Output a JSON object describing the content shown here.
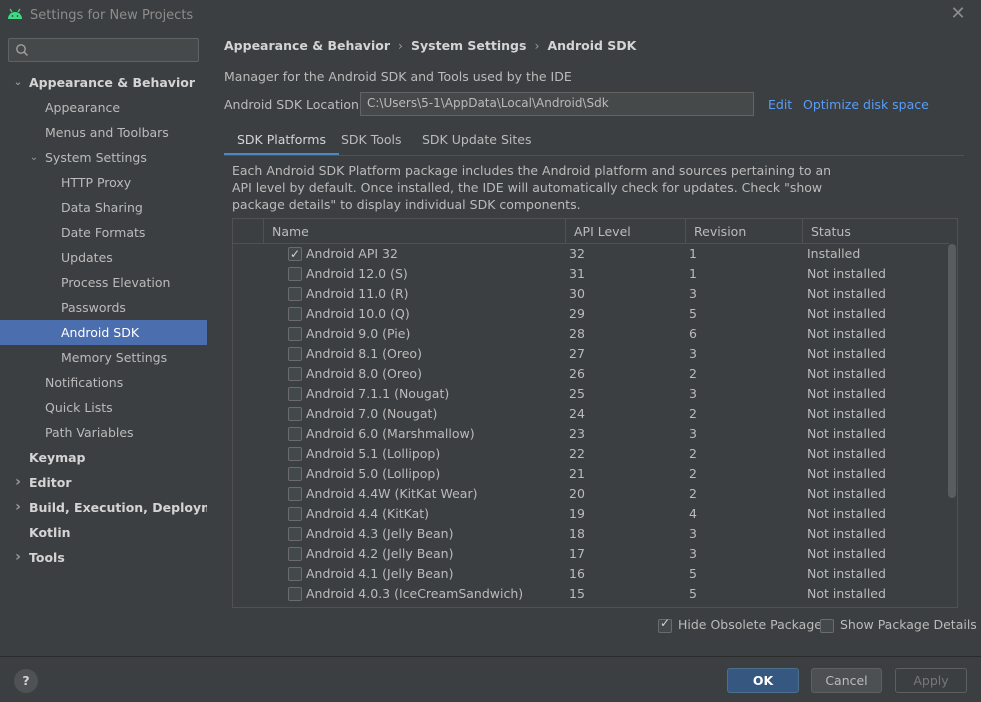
{
  "window": {
    "title": "Settings for New Projects"
  },
  "search": {
    "placeholder": ""
  },
  "sidebar": {
    "items": [
      {
        "label": "Appearance & Behavior",
        "level": 0,
        "bold": true,
        "arrow": "expanded"
      },
      {
        "label": "Appearance",
        "level": 1
      },
      {
        "label": "Menus and Toolbars",
        "level": 1
      },
      {
        "label": "System Settings",
        "level": 1,
        "arrow": "expanded"
      },
      {
        "label": "HTTP Proxy",
        "level": 2
      },
      {
        "label": "Data Sharing",
        "level": 2
      },
      {
        "label": "Date Formats",
        "level": 2
      },
      {
        "label": "Updates",
        "level": 2
      },
      {
        "label": "Process Elevation",
        "level": 2
      },
      {
        "label": "Passwords",
        "level": 2
      },
      {
        "label": "Android SDK",
        "level": 2,
        "selected": true
      },
      {
        "label": "Memory Settings",
        "level": 2
      },
      {
        "label": "Notifications",
        "level": 1
      },
      {
        "label": "Quick Lists",
        "level": 1
      },
      {
        "label": "Path Variables",
        "level": 1
      },
      {
        "label": "Keymap",
        "level": 0,
        "bold": true
      },
      {
        "label": "Editor",
        "level": 0,
        "bold": true,
        "arrow": "collapsed"
      },
      {
        "label": "Build, Execution, Deployment",
        "level": 0,
        "bold": true,
        "arrow": "collapsed"
      },
      {
        "label": "Kotlin",
        "level": 0,
        "bold": true
      },
      {
        "label": "Tools",
        "level": 0,
        "bold": true,
        "arrow": "collapsed"
      }
    ]
  },
  "breadcrumb": [
    "Appearance & Behavior",
    "System Settings",
    "Android SDK"
  ],
  "main": {
    "description": "Manager for the Android SDK and Tools used by the IDE",
    "location_label": "Android SDK Location:",
    "location_value": "C:\\Users\\5-1\\AppData\\Local\\Android\\Sdk",
    "edit_link": "Edit",
    "optimize_link": "Optimize disk space",
    "tabs": [
      "SDK Platforms",
      "SDK Tools",
      "SDK Update Sites"
    ],
    "active_tab": "SDK Platforms",
    "info": "Each Android SDK Platform package includes the Android platform and sources pertaining to an API level by default. Once installed, the IDE will automatically check for updates. Check \"show package details\" to display individual SDK components."
  },
  "table": {
    "columns": [
      "Name",
      "API Level",
      "Revision",
      "Status"
    ],
    "rows": [
      {
        "checked": true,
        "name": "Android API 32",
        "api": "32",
        "rev": "1",
        "status": "Installed"
      },
      {
        "checked": false,
        "name": "Android 12.0 (S)",
        "api": "31",
        "rev": "1",
        "status": "Not installed"
      },
      {
        "checked": false,
        "name": "Android 11.0 (R)",
        "api": "30",
        "rev": "3",
        "status": "Not installed"
      },
      {
        "checked": false,
        "name": "Android 10.0 (Q)",
        "api": "29",
        "rev": "5",
        "status": "Not installed"
      },
      {
        "checked": false,
        "name": "Android 9.0 (Pie)",
        "api": "28",
        "rev": "6",
        "status": "Not installed"
      },
      {
        "checked": false,
        "name": "Android 8.1 (Oreo)",
        "api": "27",
        "rev": "3",
        "status": "Not installed"
      },
      {
        "checked": false,
        "name": "Android 8.0 (Oreo)",
        "api": "26",
        "rev": "2",
        "status": "Not installed"
      },
      {
        "checked": false,
        "name": "Android 7.1.1 (Nougat)",
        "api": "25",
        "rev": "3",
        "status": "Not installed"
      },
      {
        "checked": false,
        "name": "Android 7.0 (Nougat)",
        "api": "24",
        "rev": "2",
        "status": "Not installed"
      },
      {
        "checked": false,
        "name": "Android 6.0 (Marshmallow)",
        "api": "23",
        "rev": "3",
        "status": "Not installed"
      },
      {
        "checked": false,
        "name": "Android 5.1 (Lollipop)",
        "api": "22",
        "rev": "2",
        "status": "Not installed"
      },
      {
        "checked": false,
        "name": "Android 5.0 (Lollipop)",
        "api": "21",
        "rev": "2",
        "status": "Not installed"
      },
      {
        "checked": false,
        "name": "Android 4.4W (KitKat Wear)",
        "api": "20",
        "rev": "2",
        "status": "Not installed"
      },
      {
        "checked": false,
        "name": "Android 4.4 (KitKat)",
        "api": "19",
        "rev": "4",
        "status": "Not installed"
      },
      {
        "checked": false,
        "name": "Android 4.3 (Jelly Bean)",
        "api": "18",
        "rev": "3",
        "status": "Not installed"
      },
      {
        "checked": false,
        "name": "Android 4.2 (Jelly Bean)",
        "api": "17",
        "rev": "3",
        "status": "Not installed"
      },
      {
        "checked": false,
        "name": "Android 4.1 (Jelly Bean)",
        "api": "16",
        "rev": "5",
        "status": "Not installed"
      },
      {
        "checked": false,
        "name": "Android 4.0.3 (IceCreamSandwich)",
        "api": "15",
        "rev": "5",
        "status": "Not installed"
      }
    ]
  },
  "options": {
    "hide_obsolete": {
      "label": "Hide Obsolete Packages",
      "checked": true
    },
    "show_details": {
      "label": "Show Package Details",
      "checked": false
    }
  },
  "footer": {
    "help": "?",
    "ok": "OK",
    "cancel": "Cancel",
    "apply": "Apply"
  },
  "colors": {
    "accent": "#4b6eaf",
    "link": "#589df6",
    "background": "#3c3f41"
  }
}
